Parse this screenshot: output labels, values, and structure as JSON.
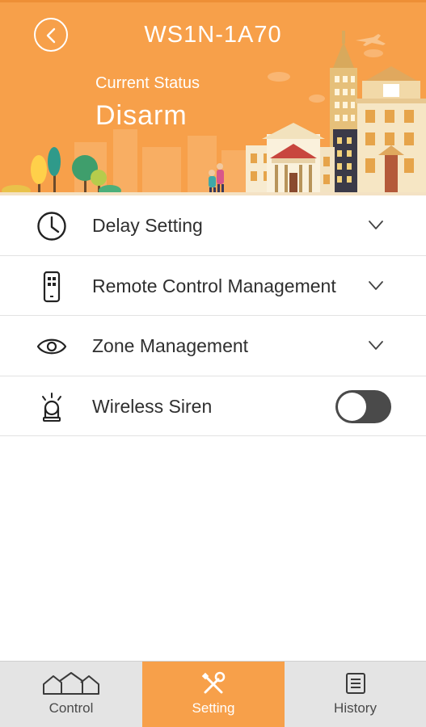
{
  "header": {
    "title": "WS1N-1A70",
    "status_label": "Current Status",
    "status_value": "Disarm",
    "brand_color": "#f7a04a"
  },
  "settings": {
    "items": [
      {
        "label": "Delay Setting",
        "icon": "clock-icon",
        "control": "chevron-down"
      },
      {
        "label": "Remote Control Management",
        "icon": "remote-control-icon",
        "control": "chevron-down"
      },
      {
        "label": "Zone Management",
        "icon": "eye-icon",
        "control": "chevron-down"
      },
      {
        "label": "Wireless Siren",
        "icon": "siren-icon",
        "control": "toggle",
        "toggle_on": false
      }
    ]
  },
  "bottom_nav": {
    "tabs": [
      {
        "label": "Control",
        "icon": "houses-icon",
        "active": false
      },
      {
        "label": "Setting",
        "icon": "tools-icon",
        "active": true
      },
      {
        "label": "History",
        "icon": "document-icon",
        "active": false
      }
    ]
  }
}
